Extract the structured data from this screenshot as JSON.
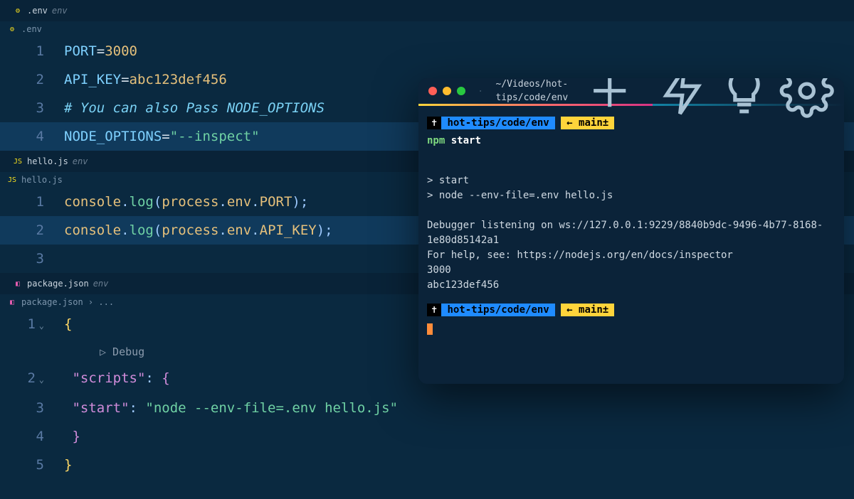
{
  "panels": {
    "env": {
      "tab": {
        "name": ".env",
        "dir": "env"
      },
      "breadcrumb": ".env",
      "lines": [
        {
          "n": "1",
          "parts": [
            [
              "var",
              "PORT"
            ],
            [
              "eq",
              "="
            ],
            [
              "val",
              "3000"
            ]
          ]
        },
        {
          "n": "2",
          "parts": [
            [
              "var",
              "API_KEY"
            ],
            [
              "eq",
              "="
            ],
            [
              "val",
              "abc123def456"
            ]
          ]
        },
        {
          "n": "3",
          "parts": [
            [
              "cmt",
              "# You can also Pass NODE_OPTIONS"
            ]
          ]
        },
        {
          "n": "4",
          "hl": true,
          "parts": [
            [
              "var",
              "NODE_OPTIONS"
            ],
            [
              "eq",
              "="
            ],
            [
              "str",
              "\"--inspect\""
            ]
          ]
        }
      ]
    },
    "hello": {
      "tab": {
        "name": "hello.js",
        "dir": "env"
      },
      "breadcrumb": "hello.js",
      "lines": [
        {
          "n": "1",
          "parts": [
            [
              "obj",
              "console"
            ],
            [
              "punc",
              "."
            ],
            [
              "fn",
              "log"
            ],
            [
              "punc",
              "("
            ],
            [
              "obj",
              "process"
            ],
            [
              "punc",
              "."
            ],
            [
              "obj",
              "env"
            ],
            [
              "punc",
              "."
            ],
            [
              "obj",
              "PORT"
            ],
            [
              "punc",
              ")"
            ],
            [
              "punc",
              ";"
            ]
          ]
        },
        {
          "n": "2",
          "hl": true,
          "parts": [
            [
              "obj",
              "console"
            ],
            [
              "punc",
              "."
            ],
            [
              "fn",
              "log"
            ],
            [
              "punc",
              "("
            ],
            [
              "obj",
              "process"
            ],
            [
              "punc",
              "."
            ],
            [
              "obj",
              "env"
            ],
            [
              "punc",
              "."
            ],
            [
              "obj",
              "API_KEY"
            ],
            [
              "punc",
              ")"
            ],
            [
              "punc",
              ";"
            ]
          ]
        },
        {
          "n": "3",
          "parts": []
        }
      ]
    },
    "package": {
      "tab": {
        "name": "package.json",
        "dir": "env"
      },
      "breadcrumb": "package.json › ...",
      "debugLens": "▷ Debug",
      "lines": [
        {
          "n": "1",
          "fold": true,
          "parts": [
            [
              "brace",
              "{"
            ]
          ]
        },
        {
          "debug": true
        },
        {
          "n": "2",
          "fold": true,
          "parts": [
            [
              "pad",
              "  "
            ],
            [
              "key",
              "\"scripts\""
            ],
            [
              "punc",
              ": "
            ],
            [
              "brace2",
              "{"
            ]
          ]
        },
        {
          "n": "3",
          "parts": [
            [
              "pad",
              "    "
            ],
            [
              "key",
              "\"start\""
            ],
            [
              "punc",
              ": "
            ],
            [
              "str",
              "\"node --env-file=.env hello.js\""
            ]
          ]
        },
        {
          "n": "4",
          "parts": [
            [
              "pad",
              "  "
            ],
            [
              "brace2",
              "}"
            ]
          ]
        },
        {
          "n": "5",
          "parts": [
            [
              "brace",
              "}"
            ]
          ]
        }
      ]
    }
  },
  "terminal": {
    "path": "~/Videos/hot-tips/code/env",
    "prompt": {
      "icon": "✝",
      "cwd": "hot-tips/code/env",
      "branch": "← main±"
    },
    "cmd": {
      "bin": "npm",
      "arg": "start"
    },
    "output": [
      "",
      "> start",
      "> node --env-file=.env hello.js",
      "",
      "Debugger listening on ws://127.0.0.1:9229/8840b9dc-9496-4b77-8168-1e80d85142a1",
      "For help, see: https://nodejs.org/en/docs/inspector",
      "3000",
      "abc123def456"
    ]
  }
}
